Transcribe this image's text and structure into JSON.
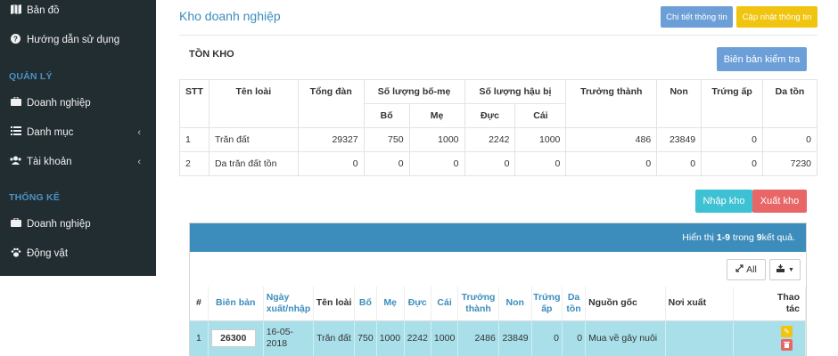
{
  "sidebar": {
    "items_top": [
      {
        "label": "Bản đồ",
        "icon": "map-icon"
      },
      {
        "label": "Hướng dẫn sử dụng",
        "icon": "question-circle-icon"
      }
    ],
    "section_manage": "QUẢN LÝ",
    "manage_items": [
      {
        "label": "Doanh nghiệp",
        "icon": "briefcase-icon"
      },
      {
        "label": "Danh mục",
        "icon": "list-icon"
      },
      {
        "label": "Tài khoản",
        "icon": "users-icon"
      }
    ],
    "section_stats": "THỐNG KÊ",
    "stats_items": [
      {
        "label": "Doanh nghiệp",
        "icon": "briefcase-icon"
      },
      {
        "label": "Động vật",
        "icon": "paw-icon"
      }
    ]
  },
  "header": {
    "title": "Kho doanh nghiệp",
    "detail_button": "Chi tiết thông tin",
    "update_button": "Cập nhật thông tin"
  },
  "stock": {
    "title": "TỒN KHO",
    "report_button": "Biên bản kiểm tra",
    "headers": {
      "stt": "STT",
      "ten_loai": "Tên loài",
      "tong_dan": "Tổng đàn",
      "bo_me": "Số lượng bố-mẹ",
      "bo": "Bố",
      "me": "Mẹ",
      "hau_bi": "Số lượng hậu bị",
      "duc": "Đực",
      "cai": "Cái",
      "truong_thanh": "Trưởng thành",
      "non": "Non",
      "trung_ap": "Trứng ấp",
      "da_ton": "Da tồn"
    },
    "rows": [
      {
        "stt": "1",
        "ten_loai": "Trăn đất",
        "tong_dan": "29327",
        "bo": "750",
        "me": "1000",
        "duc": "2242",
        "cai": "1000",
        "truong_thanh": "486",
        "non": "23849",
        "trung_ap": "0",
        "da_ton": "0"
      },
      {
        "stt": "2",
        "ten_loai": "Da trăn đất tồn",
        "tong_dan": "0",
        "bo": "0",
        "me": "0",
        "duc": "0",
        "cai": "0",
        "truong_thanh": "0",
        "non": "0",
        "trung_ap": "0",
        "da_ton": "7230"
      }
    ],
    "import_button": "Nhập kho",
    "export_button": "Xuất kho"
  },
  "log": {
    "summary_prefix": "Hiển thị ",
    "summary_range": "1-9",
    "summary_mid": " trong ",
    "summary_total": "9",
    "summary_suffix": " kết quả.",
    "all_button": "All",
    "headers": {
      "idx": "#",
      "bien_ban": "Biên bản",
      "ngay_1": "Ngày",
      "ngay_2": "xuất/nhập",
      "ten_loai": "Tên loài",
      "bo": "Bố",
      "me": "Mẹ",
      "duc": "Đực",
      "cai": "Cái",
      "tt_1": "Trưởng",
      "tt_2": "thành",
      "non": "Non",
      "ta_1": "Trứng",
      "ta_2": "ấp",
      "dt_1": "Da",
      "dt_2": "tồn",
      "nguon_goc": "Nguồn gốc",
      "noi_xuat": "Nơi xuất",
      "thao_1": "Thao",
      "thao_2": "tác"
    },
    "rows": [
      {
        "idx": "1",
        "bien_ban": "26300",
        "ngay_1": "16-05-",
        "ngay_2": "2018",
        "ten_loai": "Trăn đất",
        "bo": "750",
        "me": "1000",
        "duc": "2242",
        "cai": "1000",
        "truong_thanh": "2486",
        "non": "23849",
        "trung_ap": "0",
        "da_ton": "0",
        "nguon_goc": "Mua về gây nuôi",
        "noi_xuat": ""
      }
    ]
  },
  "colors": {
    "sidebar": "#222d32",
    "primary": "#3c8dbc",
    "warning": "#f1c40f",
    "info": "#3dc1d3",
    "danger": "#e96666",
    "row_highlight": "#a9dfe9"
  }
}
